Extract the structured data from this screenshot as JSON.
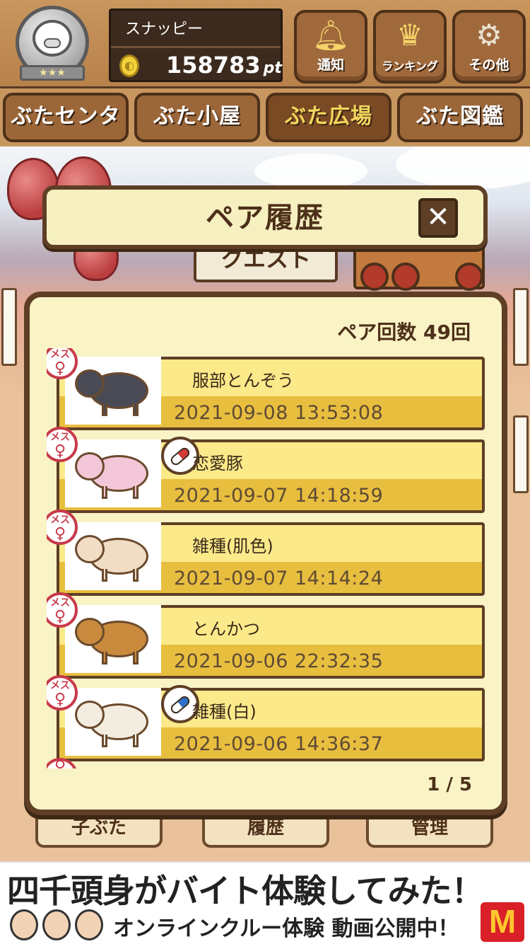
{
  "header": {
    "username": "スナッピー",
    "points": "158783",
    "points_unit": "pt",
    "rank_stars": "★★★",
    "buttons": [
      {
        "id": "notify",
        "label": "通知",
        "icon": "bell-icon"
      },
      {
        "id": "ranking",
        "label": "ランキング",
        "icon": "crown-icon"
      },
      {
        "id": "other",
        "label": "その他",
        "icon": "gear-icon"
      }
    ]
  },
  "tabs": [
    {
      "label": "ぶたセンター",
      "active": false
    },
    {
      "label": "ぶた小屋",
      "active": false
    },
    {
      "label": "ぶた広場",
      "active": true
    },
    {
      "label": "ぶた図鑑",
      "active": false
    }
  ],
  "background": {
    "sign_text": "クエスト",
    "bottom_menu": [
      "子ぶた",
      "履歴",
      "管理"
    ]
  },
  "modal": {
    "title": "ペア履歴",
    "close_label": "✕",
    "pair_count": "ペア回数 49回",
    "pager": "1 / 5",
    "items": [
      {
        "name": "服部とんぞう",
        "date": "2021-09-08 13:53:08",
        "gender": "メス",
        "capsule": null,
        "pig_color": "#4a4a55"
      },
      {
        "name": "恋愛豚",
        "date": "2021-09-07 14:18:59",
        "gender": "メス",
        "capsule": "red",
        "pig_color": "#f3c7d8"
      },
      {
        "name": "雑種(肌色)",
        "date": "2021-09-07 14:14:24",
        "gender": "メス",
        "capsule": null,
        "pig_color": "#f1dcc4"
      },
      {
        "name": "とんかつ",
        "date": "2021-09-06 22:32:35",
        "gender": "メス",
        "capsule": null,
        "pig_color": "#c98a3e"
      },
      {
        "name": "雑種(白)",
        "date": "2021-09-06 14:36:37",
        "gender": "メス",
        "capsule": "blue",
        "pig_color": "#f3ece0"
      }
    ]
  },
  "ad": {
    "headline": "四千頭身がバイト体験してみた！",
    "subline": "オンラインクルー体験 動画公開中！",
    "logo": "M"
  },
  "colors": {
    "wood": "#a0693c",
    "dark_wood": "#5e3f25",
    "panel": "#f9f3c6",
    "card": "#e8be3f",
    "female": "#c73a4a"
  }
}
